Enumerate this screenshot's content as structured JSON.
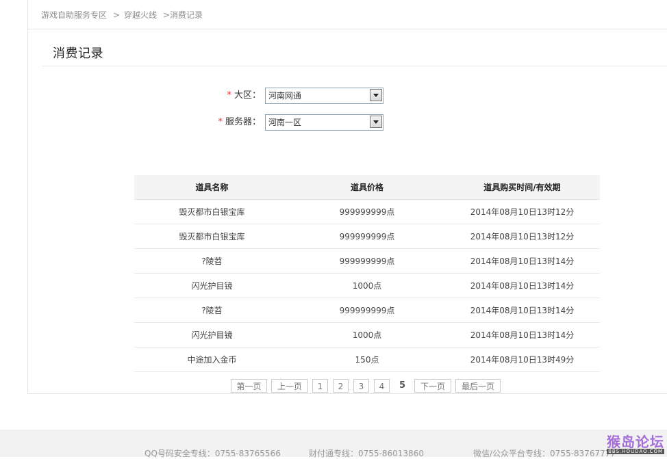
{
  "breadcrumb": {
    "home": "游戏自助服务专区",
    "sep1": ">",
    "game": "穿越火线",
    "current": ">消费记录"
  },
  "page": {
    "title": "消费记录"
  },
  "form": {
    "required_mark": "*",
    "region_label": "大区：",
    "region_value": "河南网通",
    "server_label": "服务器：",
    "server_value": "河南一区"
  },
  "table": {
    "headers": [
      "道具名称",
      "道具价格",
      "道具购买时间/有效期"
    ],
    "rows": [
      [
        "毁灭都市白银宝库",
        "999999999点",
        "2014年08月10日13时12分"
      ],
      [
        "毁灭都市白银宝库",
        "999999999点",
        "2014年08月10日13时12分"
      ],
      [
        "?陵苕",
        "999999999点",
        "2014年08月10日13时14分"
      ],
      [
        "闪光护目镜",
        "1000点",
        "2014年08月10日13时14分"
      ],
      [
        "?陵苕",
        "999999999点",
        "2014年08月10日13时14分"
      ],
      [
        "闪光护目镜",
        "1000点",
        "2014年08月10日13时14分"
      ],
      [
        "中途加入金币",
        "150点",
        "2014年08月10日13时49分"
      ]
    ]
  },
  "pager": {
    "first": "第一页",
    "prev": "上一页",
    "pages": [
      "1",
      "2",
      "3",
      "4",
      "5"
    ],
    "current_page": "5",
    "next": "下一页",
    "last": "最后一页"
  },
  "footer": {
    "qq": "QQ号码安全专线：0755-83765566",
    "tenpay": "财付通专线：0755-86013860",
    "wechat": "微信/公众平台专线：0755-83767777"
  },
  "watermark": {
    "main": "猴岛论坛",
    "sub": "BBS.HOUDAO.COM"
  },
  "colors": {
    "required": "#e0301e",
    "header_bg": "#f4f4f4",
    "footer_bg": "#f2f2f2"
  }
}
